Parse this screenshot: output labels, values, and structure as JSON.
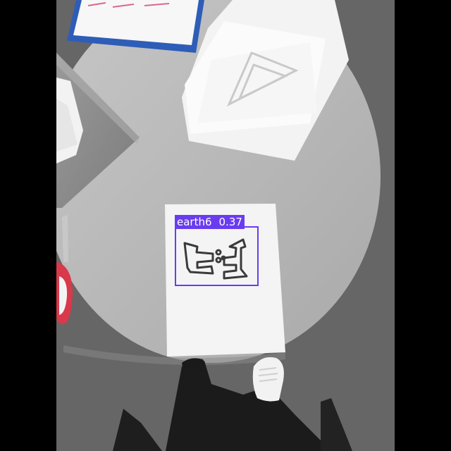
{
  "detection": {
    "class_name": "earth6",
    "confidence": "0.37",
    "box_color": "#6a3cf0"
  },
  "scene": {
    "table_color": "#bdbdbd",
    "paper_color": "#f4f4f4",
    "floor_color": "#6b6b6b",
    "letterbox_color": "#000000"
  }
}
